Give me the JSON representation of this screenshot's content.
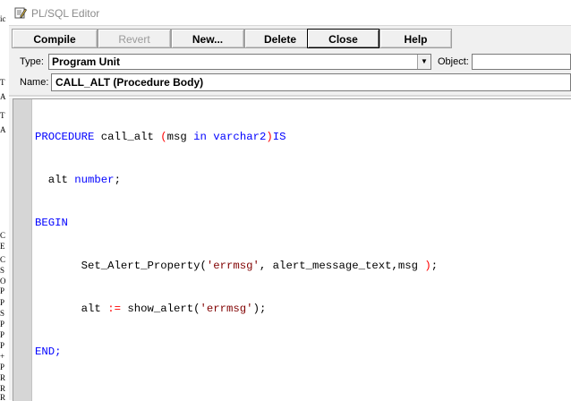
{
  "window": {
    "title": "PL/SQL Editor",
    "title_icon": "edit-pencil-icon"
  },
  "toolbar": {
    "compile": "Compile",
    "revert": "Revert",
    "new": "New...",
    "delete": "Delete",
    "close": "Close",
    "help": "Help"
  },
  "fields": {
    "type_label": "Type:",
    "type_value": "Program Unit",
    "object_label": "Object:",
    "object_value": "",
    "name_label": "Name:",
    "name_value": "CALL_ALT (Procedure Body)"
  },
  "code": {
    "l1_kw1": "PROCEDURE",
    "l1_name": " call_alt ",
    "l1_paren": "(",
    "l1_param": "msg ",
    "l1_in": "in",
    "l1_sp": " ",
    "l1_type": "varchar2",
    "l1_close": ")",
    "l1_is": "IS",
    "l2_indent": "  alt ",
    "l2_type": "number",
    "l2_semi": ";",
    "l3_begin": "BEGIN",
    "l4_call": "       Set_Alert_Property(",
    "l4_str": "'errmsg'",
    "l4_rest": ", alert_message_text,msg ",
    "l4_close": ")",
    "l4_semi": ";",
    "l5_lhs": "       alt ",
    "l5_assign": ":=",
    "l5_call": " show_alert(",
    "l5_str": "'errmsg'",
    "l5_end": ");",
    "l6_end": "END;"
  },
  "background_fragments": [
    "ic",
    "T",
    "A",
    "T",
    "A",
    "C",
    "E",
    "C",
    "S",
    "O",
    "P",
    "P",
    "S",
    "P",
    "P",
    "P",
    "+",
    "P",
    "R",
    "R",
    "R"
  ],
  "colors": {
    "keyword": "#0000ff",
    "string": "#800000",
    "operator": "#ff0000",
    "gutter": "#d6d6d6",
    "window_bg": "#f0f0f0"
  }
}
